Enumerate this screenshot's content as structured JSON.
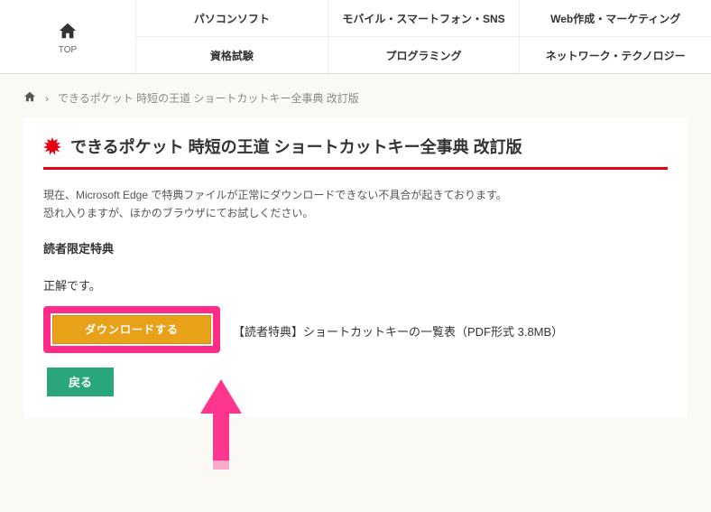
{
  "nav": {
    "top_label": "TOP",
    "items": [
      [
        "パソコンソフト",
        "モバイル・スマートフォン・SNS",
        "Web作成・マーケティング"
      ],
      [
        "資格試験",
        "プログラミング",
        "ネットワーク・テクノロジー"
      ]
    ]
  },
  "breadcrumb": {
    "sep": "›",
    "current": "できるポケット 時短の王道 ショートカットキー全事典 改訂版"
  },
  "page": {
    "title": "できるポケット 時短の王道 ショートカットキー全事典 改訂版",
    "notice_line1": "現在、Microsoft Edge で特典ファイルが正常にダウンロードできない不具合が起きております。",
    "notice_line2": "恐れ入りますが、ほかのブラウザにてお試しください。",
    "section_heading": "読者限定特典",
    "correct_text": "正解です。",
    "download_label": "ダウンロードする",
    "download_desc": "【読者特典】ショートカットキーの一覧表（PDF形式 3.8MB）",
    "back_label": "戻る"
  },
  "colors": {
    "accent": "#e60012",
    "download": "#e8a21a",
    "back": "#2aa77a",
    "highlight": "#ff2b88"
  }
}
